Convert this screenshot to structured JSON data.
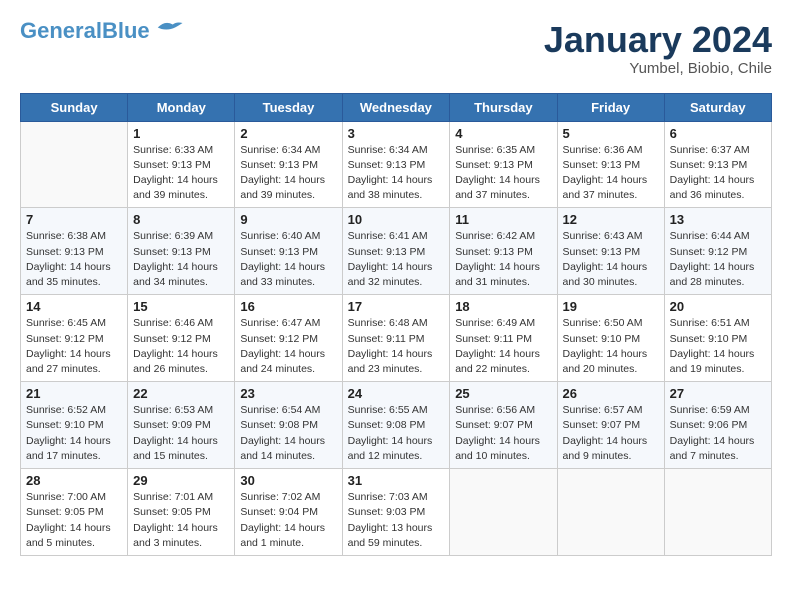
{
  "header": {
    "logo_line1": "General",
    "logo_line2": "Blue",
    "month_title": "January 2024",
    "subtitle": "Yumbel, Biobio, Chile"
  },
  "weekdays": [
    "Sunday",
    "Monday",
    "Tuesday",
    "Wednesday",
    "Thursday",
    "Friday",
    "Saturday"
  ],
  "weeks": [
    [
      {
        "day": "",
        "info": ""
      },
      {
        "day": "1",
        "info": "Sunrise: 6:33 AM\nSunset: 9:13 PM\nDaylight: 14 hours\nand 39 minutes."
      },
      {
        "day": "2",
        "info": "Sunrise: 6:34 AM\nSunset: 9:13 PM\nDaylight: 14 hours\nand 39 minutes."
      },
      {
        "day": "3",
        "info": "Sunrise: 6:34 AM\nSunset: 9:13 PM\nDaylight: 14 hours\nand 38 minutes."
      },
      {
        "day": "4",
        "info": "Sunrise: 6:35 AM\nSunset: 9:13 PM\nDaylight: 14 hours\nand 37 minutes."
      },
      {
        "day": "5",
        "info": "Sunrise: 6:36 AM\nSunset: 9:13 PM\nDaylight: 14 hours\nand 37 minutes."
      },
      {
        "day": "6",
        "info": "Sunrise: 6:37 AM\nSunset: 9:13 PM\nDaylight: 14 hours\nand 36 minutes."
      }
    ],
    [
      {
        "day": "7",
        "info": "Sunrise: 6:38 AM\nSunset: 9:13 PM\nDaylight: 14 hours\nand 35 minutes."
      },
      {
        "day": "8",
        "info": "Sunrise: 6:39 AM\nSunset: 9:13 PM\nDaylight: 14 hours\nand 34 minutes."
      },
      {
        "day": "9",
        "info": "Sunrise: 6:40 AM\nSunset: 9:13 PM\nDaylight: 14 hours\nand 33 minutes."
      },
      {
        "day": "10",
        "info": "Sunrise: 6:41 AM\nSunset: 9:13 PM\nDaylight: 14 hours\nand 32 minutes."
      },
      {
        "day": "11",
        "info": "Sunrise: 6:42 AM\nSunset: 9:13 PM\nDaylight: 14 hours\nand 31 minutes."
      },
      {
        "day": "12",
        "info": "Sunrise: 6:43 AM\nSunset: 9:13 PM\nDaylight: 14 hours\nand 30 minutes."
      },
      {
        "day": "13",
        "info": "Sunrise: 6:44 AM\nSunset: 9:12 PM\nDaylight: 14 hours\nand 28 minutes."
      }
    ],
    [
      {
        "day": "14",
        "info": "Sunrise: 6:45 AM\nSunset: 9:12 PM\nDaylight: 14 hours\nand 27 minutes."
      },
      {
        "day": "15",
        "info": "Sunrise: 6:46 AM\nSunset: 9:12 PM\nDaylight: 14 hours\nand 26 minutes."
      },
      {
        "day": "16",
        "info": "Sunrise: 6:47 AM\nSunset: 9:12 PM\nDaylight: 14 hours\nand 24 minutes."
      },
      {
        "day": "17",
        "info": "Sunrise: 6:48 AM\nSunset: 9:11 PM\nDaylight: 14 hours\nand 23 minutes."
      },
      {
        "day": "18",
        "info": "Sunrise: 6:49 AM\nSunset: 9:11 PM\nDaylight: 14 hours\nand 22 minutes."
      },
      {
        "day": "19",
        "info": "Sunrise: 6:50 AM\nSunset: 9:10 PM\nDaylight: 14 hours\nand 20 minutes."
      },
      {
        "day": "20",
        "info": "Sunrise: 6:51 AM\nSunset: 9:10 PM\nDaylight: 14 hours\nand 19 minutes."
      }
    ],
    [
      {
        "day": "21",
        "info": "Sunrise: 6:52 AM\nSunset: 9:10 PM\nDaylight: 14 hours\nand 17 minutes."
      },
      {
        "day": "22",
        "info": "Sunrise: 6:53 AM\nSunset: 9:09 PM\nDaylight: 14 hours\nand 15 minutes."
      },
      {
        "day": "23",
        "info": "Sunrise: 6:54 AM\nSunset: 9:08 PM\nDaylight: 14 hours\nand 14 minutes."
      },
      {
        "day": "24",
        "info": "Sunrise: 6:55 AM\nSunset: 9:08 PM\nDaylight: 14 hours\nand 12 minutes."
      },
      {
        "day": "25",
        "info": "Sunrise: 6:56 AM\nSunset: 9:07 PM\nDaylight: 14 hours\nand 10 minutes."
      },
      {
        "day": "26",
        "info": "Sunrise: 6:57 AM\nSunset: 9:07 PM\nDaylight: 14 hours\nand 9 minutes."
      },
      {
        "day": "27",
        "info": "Sunrise: 6:59 AM\nSunset: 9:06 PM\nDaylight: 14 hours\nand 7 minutes."
      }
    ],
    [
      {
        "day": "28",
        "info": "Sunrise: 7:00 AM\nSunset: 9:05 PM\nDaylight: 14 hours\nand 5 minutes."
      },
      {
        "day": "29",
        "info": "Sunrise: 7:01 AM\nSunset: 9:05 PM\nDaylight: 14 hours\nand 3 minutes."
      },
      {
        "day": "30",
        "info": "Sunrise: 7:02 AM\nSunset: 9:04 PM\nDaylight: 14 hours\nand 1 minute."
      },
      {
        "day": "31",
        "info": "Sunrise: 7:03 AM\nSunset: 9:03 PM\nDaylight: 13 hours\nand 59 minutes."
      },
      {
        "day": "",
        "info": ""
      },
      {
        "day": "",
        "info": ""
      },
      {
        "day": "",
        "info": ""
      }
    ]
  ]
}
